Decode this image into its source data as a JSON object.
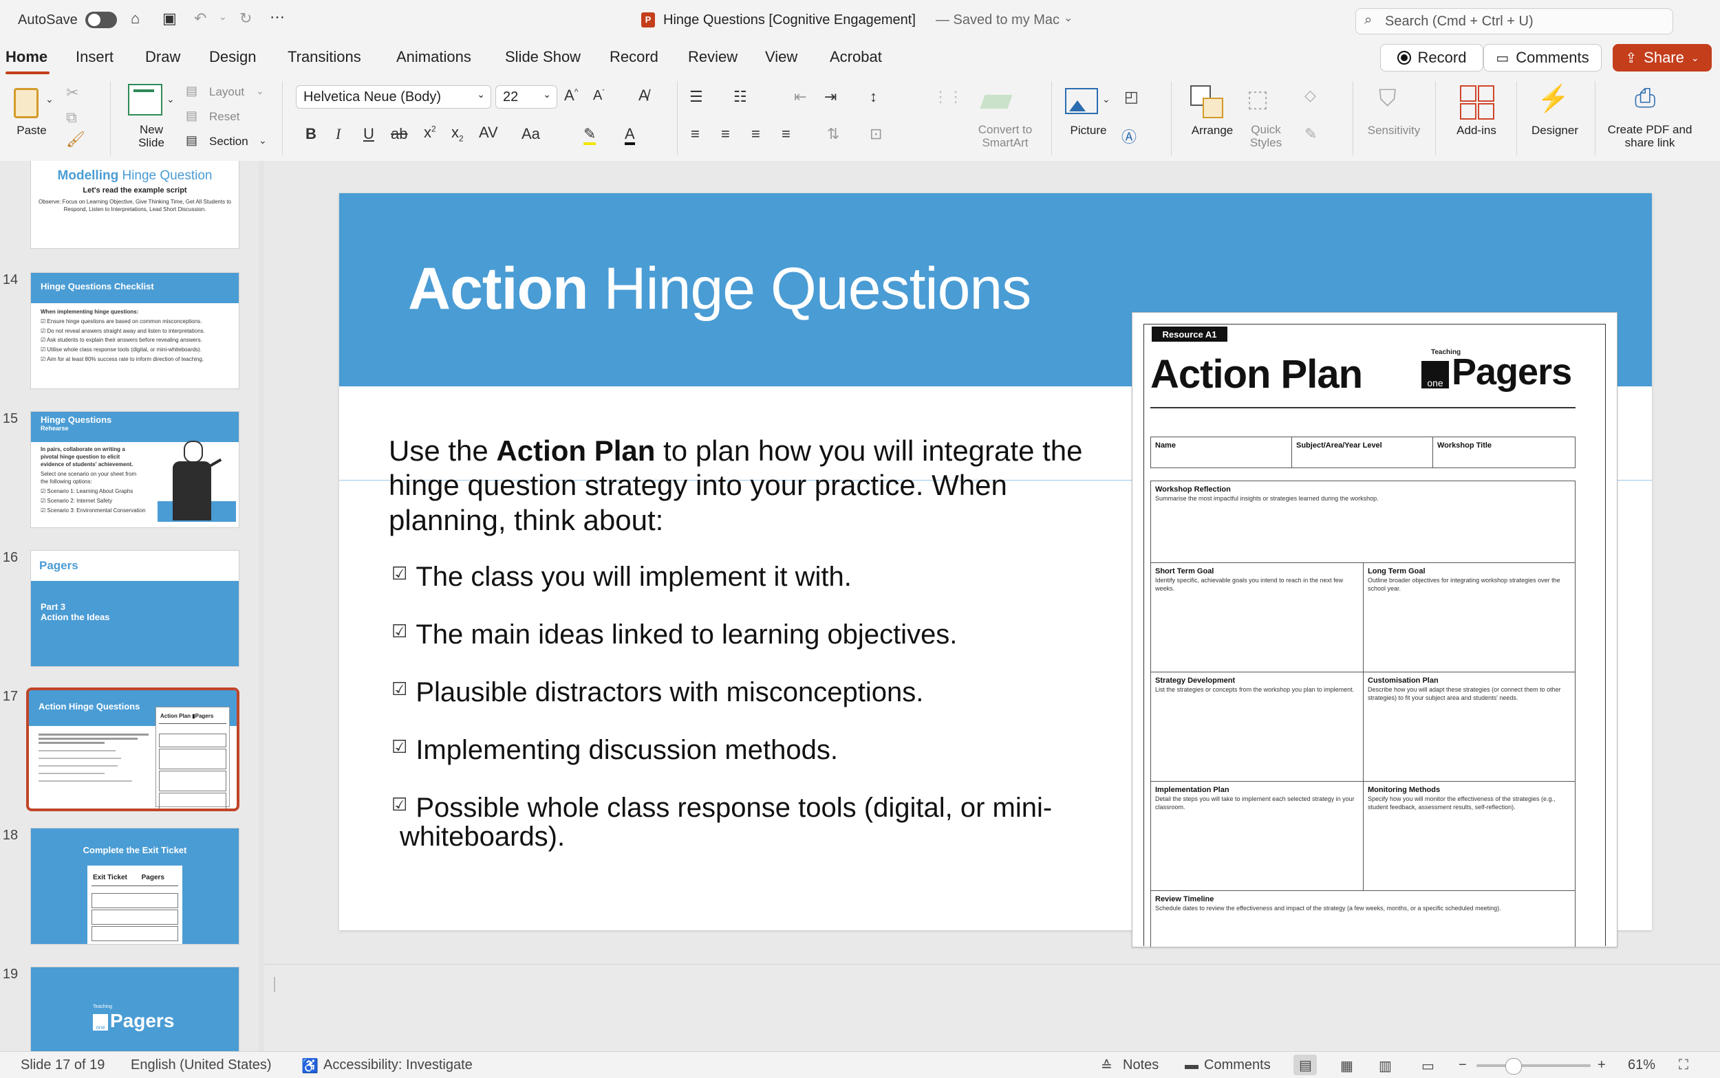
{
  "titlebar": {
    "autosave_label": "AutoSave",
    "doc_title": "Hinge Questions [Cognitive Engagement]",
    "save_status": "— Saved to my Mac",
    "search_placeholder": "Search (Cmd + Ctrl + U)"
  },
  "tabs": [
    "Home",
    "Insert",
    "Draw",
    "Design",
    "Transitions",
    "Animations",
    "Slide Show",
    "Record",
    "Review",
    "View",
    "Acrobat"
  ],
  "top_buttons": {
    "record": "Record",
    "comments": "Comments",
    "share": "Share"
  },
  "ribbon": {
    "paste": "Paste",
    "new_slide": "New Slide",
    "layout": "Layout",
    "reset": "Reset",
    "section": "Section",
    "font_name": "Helvetica Neue (Body)",
    "font_size": "22",
    "convert_smartart": "Convert to SmartArt",
    "picture": "Picture",
    "arrange": "Arrange",
    "quick_styles": "Quick Styles",
    "sensitivity": "Sensitivity",
    "addins": "Add-ins",
    "designer": "Designer",
    "create_pdf": "Create PDF and share link"
  },
  "thumbnails": [
    {
      "num": "",
      "title_a": "Modelling",
      "title_b": "Hinge Question",
      "subtitle": "Let's read the example script",
      "body": "Observe: Focus on Learning Objective, Give Thinking Time, Get All Students to Respond, Listen to Interpretations, Lead Short Discussion."
    },
    {
      "num": "14",
      "title": "Hinge Questions Checklist",
      "lead": "When implementing hinge questions:",
      "items": [
        "Ensure hinge questions are based on common misconceptions.",
        "Do not reveal answers straight away and listen to interpretations.",
        "Ask students to explain their answers before revealing answers.",
        "Utilise whole class response tools (digital, or mini-whiteboards).",
        "Aim for at least 80% success rate to inform direction of teaching."
      ]
    },
    {
      "num": "15",
      "title": "Hinge Questions",
      "subtitle": "Rehearse",
      "lead": "In pairs, collaborate on writing a pivotal hinge question to elicit evidence of students' achievement.",
      "select": "Select one scenario on your sheet from the following options:",
      "items": [
        "Scenario 1: Learning About Graphs",
        "Scenario 2: Internet Safety",
        "Scenario 3: Environmental Conservation"
      ]
    },
    {
      "num": "16",
      "logo": "Pagers",
      "part": "Part 3",
      "part_title": "Action the Ideas"
    },
    {
      "num": "17",
      "title": "Action Hinge Questions"
    },
    {
      "num": "18",
      "title": "Complete the Exit Ticket",
      "sheet_title": "Exit Ticket",
      "logo": "Pagers"
    },
    {
      "num": "19",
      "logo": "Pagers",
      "logo_small": "Teaching",
      "logo_box": "one"
    }
  ],
  "slide": {
    "title_bold": "Action",
    "title_rest": " Hinge Questions",
    "intro_a": "Use the ",
    "intro_bold": "Action Plan",
    "intro_b": " to plan how you will integrate the hinge question strategy into your practice. When planning, think about:",
    "bullets": [
      "The class you will implement it with.",
      "The main ideas linked to learning objectives.",
      "Plausible distractors with misconceptions.",
      "Implementing discussion methods.",
      "Possible whole class response tools (digital, or mini-",
      "whiteboards)."
    ],
    "check_glyph": "☑"
  },
  "action_plan": {
    "resource_tag": "Resource A1",
    "title": "Action Plan",
    "logo_small": "Teaching",
    "logo_box": "one",
    "logo_text": "Pagers",
    "fields": [
      "Name",
      "Subject/Area/Year Level",
      "Workshop Title"
    ],
    "reflection_title": "Workshop Reflection",
    "reflection_desc": "Summarise the most impactful insights or strategies learned during the workshop.",
    "short_goal_title": "Short Term Goal",
    "short_goal_desc": "Identify specific, achievable goals you intend to reach in the next few weeks.",
    "long_goal_title": "Long Term Goal",
    "long_goal_desc": "Outline broader objectives for integrating workshop strategies over the school year.",
    "strategy_title": "Strategy Development",
    "strategy_desc": "List the strategies or concepts from the workshop you plan to implement.",
    "custom_title": "Customisation Plan",
    "custom_desc": "Describe how you will adapt these strategies (or connect them to other strategies) to fit your subject area and students' needs.",
    "impl_title": "Implementation Plan",
    "impl_desc": "Detail the steps you will take to implement each selected strategy in your classroom.",
    "monitor_title": "Monitoring Methods",
    "monitor_desc": "Specify how you will monitor the effectiveness of the strategies (e.g., student feedback, assessment results, self-reflection).",
    "review_title": "Review Timeline",
    "review_desc": "Schedule dates to review the effectiveness and impact of the strategy (a few weeks, months, or a specific scheduled meeting)."
  },
  "status": {
    "slide_count": "Slide 17 of 19",
    "language": "English (United States)",
    "accessibility": "Accessibility: Investigate",
    "notes": "Notes",
    "comments": "Comments",
    "zoom": "61%",
    "zoom_level": 0.61
  },
  "colors": {
    "accent": "#c43e1c",
    "slide_blue": "#4a9cd4",
    "selected_border": "#c0452a"
  }
}
